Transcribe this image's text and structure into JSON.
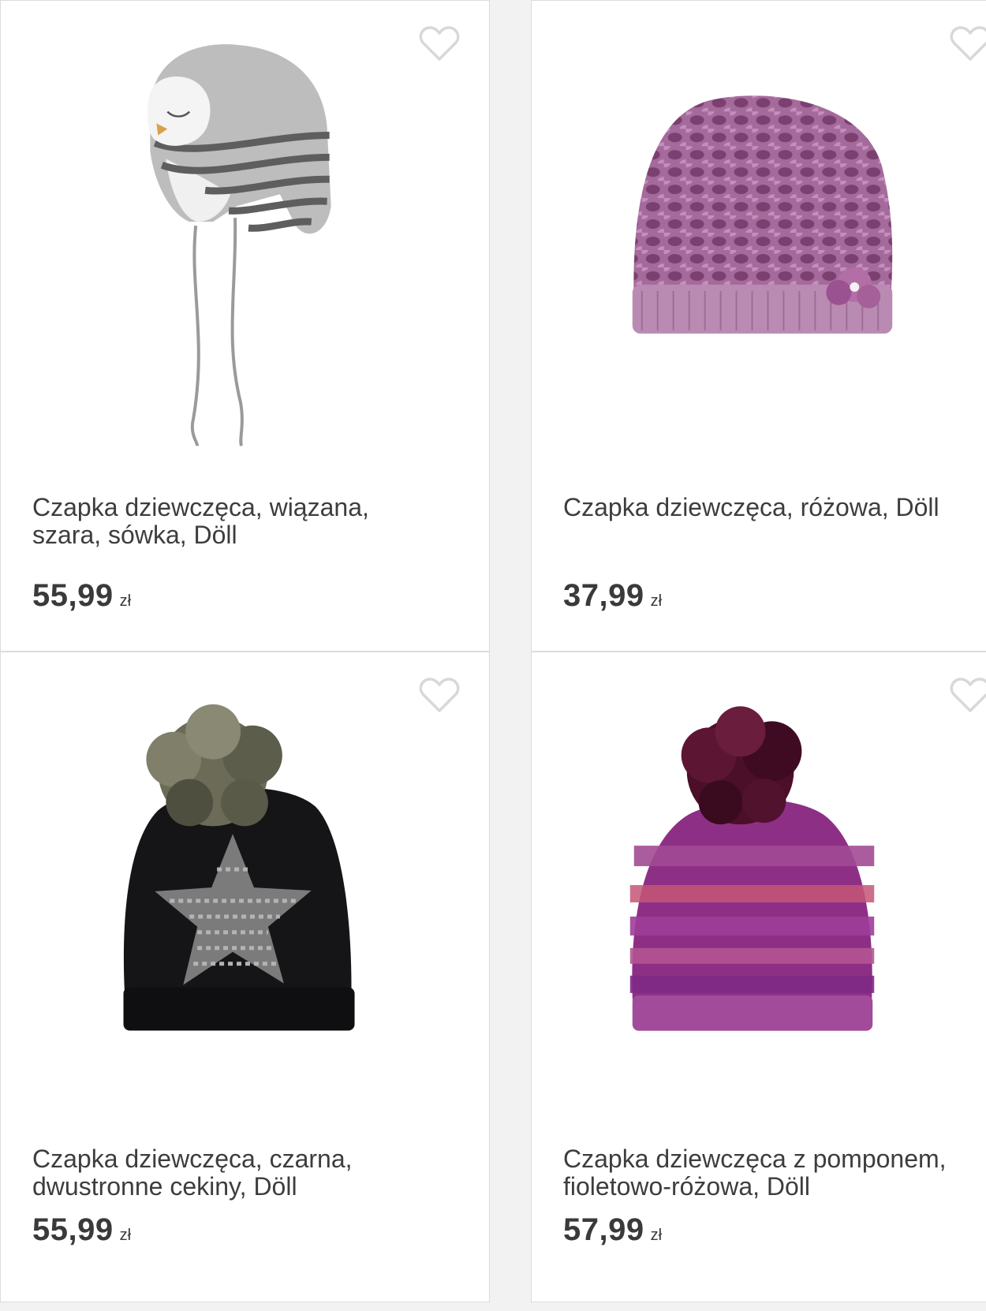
{
  "products": [
    {
      "title_line1": "Czapka dziewczęca, wiązana,",
      "title_line2": "szara, sówka, Döll",
      "price": "55,99",
      "currency": "zł",
      "icon": "heart-outline-icon",
      "image": "gray-striped-owl-trapper-hat"
    },
    {
      "title_line1": "Czapka dziewczęca, różowa, Döll",
      "title_line2": "",
      "price": "37,99",
      "currency": "zł",
      "icon": "heart-outline-icon",
      "image": "pink-knit-beanie-with-flower"
    },
    {
      "title_line1": "Czapka dziewczęca, czarna,",
      "title_line2": "dwustronne cekiny, Döll",
      "price": "55,99",
      "currency": "zł",
      "icon": "heart-outline-icon",
      "image": "black-pompom-beanie-with-sequin-star"
    },
    {
      "title_line1": "Czapka dziewczęca z pomponem,",
      "title_line2": "fioletowo-różowa, Döll",
      "price": "57,99",
      "currency": "zł",
      "icon": "heart-outline-icon",
      "image": "purple-pink-striped-pompom-beanie"
    }
  ],
  "colors": {
    "heart_outline": "#d8d8d8",
    "text": "#3d3d3d",
    "card_border": "#dcdcdc",
    "page_background": "#f2f2f2"
  }
}
